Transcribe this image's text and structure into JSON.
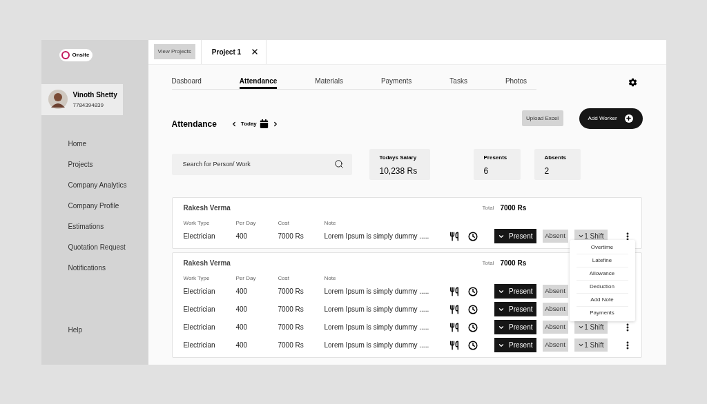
{
  "app": {
    "logo": "Onsite"
  },
  "user": {
    "name": "Vinoth Shetty",
    "phone": "7784394839"
  },
  "sidebar": {
    "items": [
      "Home",
      "Projects",
      "Company Analytics",
      "Company Profile",
      "Estimations",
      "Quotation Request",
      "Notifications"
    ],
    "footer": "Help"
  },
  "top_bar": {
    "view_projects": "View Projects",
    "project_tab": "Project 1"
  },
  "nav_tabs": [
    {
      "label": "Dasboard",
      "selected": false
    },
    {
      "label": "Attendance",
      "selected": true
    },
    {
      "label": "Materials",
      "selected": false
    },
    {
      "label": "Payments",
      "selected": false
    },
    {
      "label": "Tasks",
      "selected": false
    },
    {
      "label": "Photos",
      "selected": false
    }
  ],
  "header": {
    "title": "Attendance",
    "date": "Today",
    "upload_button": "Upload Excel",
    "add_button": "Add Worker"
  },
  "search": {
    "placeholder": "Search for Person/ Work"
  },
  "stats": [
    {
      "label": "Todays Salary",
      "value": "10,238 Rs"
    },
    {
      "label": "Presents",
      "value": "6"
    },
    {
      "label": "Absents",
      "value": "2"
    }
  ],
  "cards": [
    {
      "name": "Rakesh Verma",
      "total_label": "Total",
      "total": "7000 Rs",
      "columns": [
        "Work Type",
        "Per Day",
        "Cost",
        "Note"
      ],
      "rows": [
        {
          "work_type": "Electrician",
          "per_day": "400",
          "cost": "7000 Rs",
          "note": "Lorem Ipsum is simply dummy .....",
          "status": "Present",
          "absent": "Absent",
          "shift": "1 Shift",
          "more": true
        }
      ]
    },
    {
      "name": "Rakesh Verma",
      "total_label": "Total",
      "total": "7000 Rs",
      "columns": [
        "Work Type",
        "Per Day",
        "Cost",
        "Note"
      ],
      "rows": [
        {
          "work_type": "Electrician",
          "per_day": "400",
          "cost": "7000 Rs",
          "note": "Lorem Ipsum is simply dummy .....",
          "status": "Present",
          "absent": "Absent",
          "more": false
        },
        {
          "work_type": "Electrician",
          "per_day": "400",
          "cost": "7000 Rs",
          "note": "Lorem Ipsum is simply dummy .....",
          "status": "Present",
          "absent": "Absent",
          "more": false
        },
        {
          "work_type": "Electrician",
          "per_day": "400",
          "cost": "7000 Rs",
          "note": "Lorem Ipsum is simply dummy .....",
          "status": "Present",
          "absent": "Absent",
          "shift": "1 Shift",
          "more": true
        },
        {
          "work_type": "Electrician",
          "per_day": "400",
          "cost": "7000 Rs",
          "note": "Lorem Ipsum is simply dummy .....",
          "status": "Present",
          "absent": "Absent",
          "shift": "1 Shift",
          "more": true
        }
      ]
    }
  ],
  "menu": {
    "items": [
      "Overtime",
      "Latefine",
      "Allowance",
      "Deduction",
      "Add Note",
      "Payments"
    ]
  }
}
